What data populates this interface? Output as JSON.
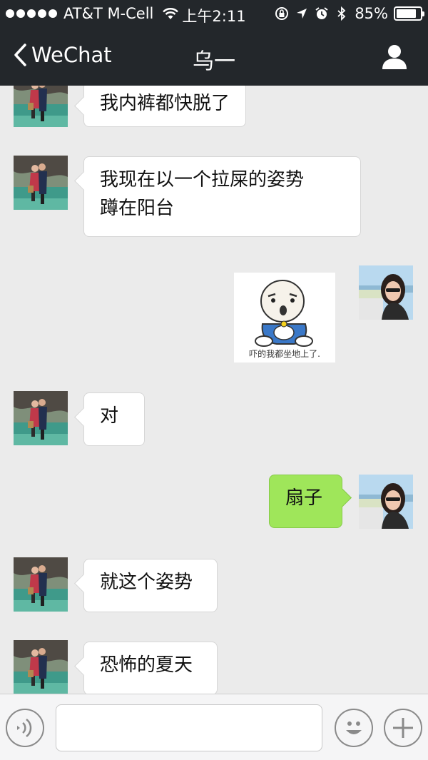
{
  "status_bar": {
    "carrier": "AT&T M-Cell",
    "time": "上午2:11",
    "battery_percent": "85%",
    "battery_level": 0.85
  },
  "nav": {
    "back_label": "WeChat",
    "title": "乌一"
  },
  "messages": [
    {
      "side": "in",
      "type": "text",
      "lines": [
        "我内裤都快脱了"
      ]
    },
    {
      "side": "in",
      "type": "text",
      "lines": [
        "我现在以一个拉屎的姿势",
        "蹲在阳台"
      ]
    },
    {
      "side": "out",
      "type": "sticker",
      "caption": "吓的我都坐地上了."
    },
    {
      "side": "in",
      "type": "text",
      "lines": [
        "对"
      ]
    },
    {
      "side": "out",
      "type": "text",
      "lines": [
        "扇子"
      ]
    },
    {
      "side": "in",
      "type": "text",
      "lines": [
        "就这个姿势"
      ]
    },
    {
      "side": "in",
      "type": "text",
      "lines": [
        "恐怖的夏天"
      ]
    }
  ],
  "input": {
    "value": "",
    "placeholder": ""
  },
  "icons": {
    "voice": "voice-toggle-icon",
    "emoji": "emoji-icon",
    "plus": "plus-icon"
  },
  "colors": {
    "header": "#23272b",
    "chat_background": "#ebebeb",
    "outgoing_bubble": "#9fe65a",
    "incoming_bubble": "#ffffff"
  }
}
